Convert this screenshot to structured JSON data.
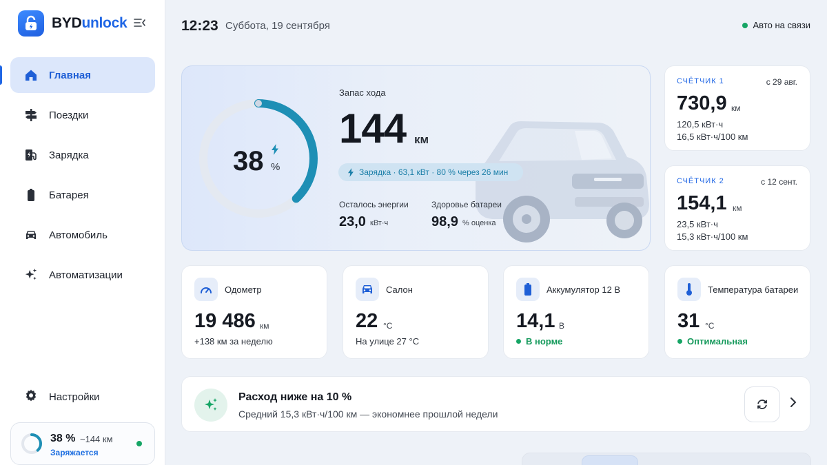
{
  "app": {
    "brand_part1": "BYD",
    "brand_part2": "unlock"
  },
  "colors": {
    "accent": "#1f66e5",
    "active_bg": "#dce7fb",
    "ok": "#16a565",
    "gauge": "#1e8fb5"
  },
  "sidebar": {
    "items": [
      {
        "label": "Главная",
        "icon": "home-icon"
      },
      {
        "label": "Поездки",
        "icon": "signpost-icon"
      },
      {
        "label": "Зарядка",
        "icon": "charging-station-icon"
      },
      {
        "label": "Батарея",
        "icon": "battery-icon"
      },
      {
        "label": "Автомобиль",
        "icon": "car-icon"
      },
      {
        "label": "Автоматизации",
        "icon": "sparkles-icon"
      }
    ],
    "active_index": 0,
    "settings_label": "Настройки",
    "mini": {
      "percent": "38 %",
      "range": "~144 км",
      "state": "Заряжается",
      "level": 0.38
    }
  },
  "header": {
    "time": "12:23",
    "date": "Суббота, 19 сентября",
    "status": "Авто на связи"
  },
  "hero": {
    "soc_value": "38",
    "soc_unit": "%",
    "soc_level": 0.38,
    "range_label": "Запас хода",
    "range_value": "144",
    "range_unit": "км",
    "charging_text": "Зарядка · 63,1 кВт · 80 % через 26 мин",
    "energy_label": "Осталось энергии",
    "energy_value": "23,0",
    "energy_unit": "кВт·ч",
    "health_label": "Здоровье батареи",
    "health_value": "98,9",
    "health_unit": "%  оценка"
  },
  "trips": [
    {
      "name": "СЧЁТЧИК 1",
      "since": "с 29 авг.",
      "value": "730,9",
      "unit": "км",
      "energy": "120,5 кВт·ч",
      "consumption": "16,5 кВт·ч/100 км"
    },
    {
      "name": "СЧЁТЧИК 2",
      "since": "с 12 сент.",
      "value": "154,1",
      "unit": "км",
      "energy": "23,5 кВт·ч",
      "consumption": "15,3 кВт·ч/100 км"
    }
  ],
  "cards": [
    {
      "title": "Одометр",
      "value": "19 486",
      "unit": "км",
      "sub": "+138 км за неделю",
      "icon": "speedometer-icon"
    },
    {
      "title": "Салон",
      "value": "22",
      "unit": "°C",
      "sub": "На улице 27 °C",
      "icon": "car-front-icon"
    },
    {
      "title": "Аккумулятор 12 В",
      "value": "14,1",
      "unit": "В",
      "sub": "В норме",
      "icon": "battery-12v-icon"
    },
    {
      "title": "Температура батареи",
      "value": "31",
      "unit": "°C",
      "sub": "Оптимальная",
      "icon": "thermometer-icon"
    }
  ],
  "insight": {
    "title": "Расход ниже на 10 %",
    "subtitle": "Средний 15,3 кВт·ч/100 км — экономнее прошлой недели",
    "icon": "sparkles-icon"
  }
}
